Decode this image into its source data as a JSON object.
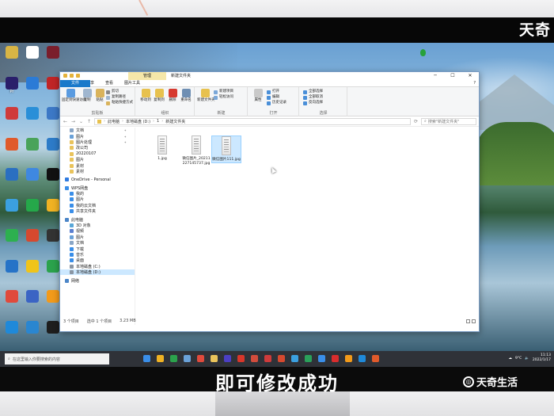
{
  "brand": {
    "top": "天奇",
    "bottom": "天奇生活"
  },
  "subtitle": "即可修改成功",
  "desktop": {
    "icons": [
      {
        "label": "",
        "color": "#d8b545"
      },
      {
        "label": "",
        "color": "#fff"
      },
      {
        "label": "",
        "color": "#7a1e2c"
      },
      {
        "label": "Pr",
        "color": "#2a1f6b"
      },
      {
        "label": "",
        "color": "#2b7bd6"
      },
      {
        "label": "",
        "color": "#c02526"
      },
      {
        "label": "",
        "color": "#cf3b3b"
      },
      {
        "label": "",
        "color": "#2a8fd8"
      },
      {
        "label": "",
        "color": "#3c78c6"
      },
      {
        "label": "",
        "color": "#e05a2b"
      },
      {
        "label": "",
        "color": "#4aa35a"
      },
      {
        "label": "",
        "color": "#2d7bc8"
      },
      {
        "label": "",
        "color": "#2a6fc1"
      },
      {
        "label": "",
        "color": "#3f88e0"
      },
      {
        "label": "",
        "color": "#111"
      },
      {
        "label": "",
        "color": "#3ba0e0"
      },
      {
        "label": "",
        "color": "#25a84a"
      },
      {
        "label": "",
        "color": "#f0b223"
      },
      {
        "label": "",
        "color": "#2db04f"
      },
      {
        "label": "",
        "color": "#d6492f"
      },
      {
        "label": "",
        "color": "#333"
      },
      {
        "label": "",
        "color": "#2673c7"
      },
      {
        "label": "",
        "color": "#f0c419"
      },
      {
        "label": "",
        "color": "#2ba24c"
      },
      {
        "label": "",
        "color": "#e04a3c"
      },
      {
        "label": "",
        "color": "#3b64c4"
      },
      {
        "label": "",
        "color": "#f29a1a"
      },
      {
        "label": "",
        "color": "#1f89d9"
      },
      {
        "label": "",
        "color": "#2a86d0"
      },
      {
        "label": "",
        "color": "#1e1e1e"
      }
    ]
  },
  "window": {
    "context_tab": "管理",
    "title": "新建文件夹",
    "controls": [
      "─",
      "☐",
      "✕"
    ],
    "tabs": {
      "file": "文件",
      "home": "主页",
      "share": "共享",
      "view": "查看",
      "picture_tools": "图片工具"
    },
    "help": "?",
    "ribbon": {
      "pin": "固定到快速访问",
      "copy": "复制",
      "paste": "粘贴",
      "cut": "剪切",
      "copy_path": "复制路径",
      "paste_shortcut": "粘贴快捷方式",
      "clipboard": "剪贴板",
      "move_to": "移动到",
      "copy_to": "复制到",
      "delete": "删除",
      "rename": "重命名",
      "organize": "组织",
      "new_item": "新建项目",
      "easy_access": "轻松访问",
      "new_folder": "新建文件夹",
      "new": "新建",
      "properties": "属性",
      "open": "打开",
      "edit": "编辑",
      "history": "历史记录",
      "open_group": "打开",
      "select_all": "全部选择",
      "select_none": "全部取消",
      "invert": "反向选择",
      "select_group": "选择"
    },
    "address": {
      "crumbs": [
        "此电脑",
        "本地磁盘 (D:)",
        "1",
        "新建文件夹"
      ],
      "search_placeholder": "搜索\"新建文件夹\""
    },
    "nav": [
      {
        "label": "文档",
        "color": "#8aa6c6",
        "pin": true
      },
      {
        "label": "图片",
        "color": "#6aa1d8",
        "pin": true
      },
      {
        "label": "图片处理",
        "color": "#e9c35b",
        "pin": true
      },
      {
        "label": "改公司",
        "color": "#e9c35b",
        "pin": false
      },
      {
        "label": "20220107",
        "color": "#e9c35b",
        "pin": false
      },
      {
        "label": "图片",
        "color": "#e9c35b",
        "pin": false
      },
      {
        "label": "素材",
        "color": "#e9c35b",
        "pin": false
      },
      {
        "label": "素材",
        "color": "#e9c35b",
        "pin": false
      },
      {
        "label": "OneDrive - Personal",
        "color": "#2f7be0",
        "pin": false,
        "head": true
      },
      {
        "label": "WPS网盘",
        "color": "#3a8ee8",
        "pin": false,
        "head": true
      },
      {
        "label": "我的",
        "color": "#3a8ee8",
        "pin": false
      },
      {
        "label": "图片",
        "color": "#3a8ee8",
        "pin": false
      },
      {
        "label": "我的云文档",
        "color": "#3a8ee8",
        "pin": false
      },
      {
        "label": "共享文件夹",
        "color": "#3a8ee8",
        "pin": false
      },
      {
        "label": "此电脑",
        "color": "#4c86c8",
        "pin": false,
        "head": true
      },
      {
        "label": "3D 对象",
        "color": "#59a7d8",
        "pin": false
      },
      {
        "label": "视频",
        "color": "#5a7fd0",
        "pin": false
      },
      {
        "label": "图片",
        "color": "#6aa1d8",
        "pin": false
      },
      {
        "label": "文档",
        "color": "#8aa6c6",
        "pin": false
      },
      {
        "label": "下载",
        "color": "#3a8ee8",
        "pin": false
      },
      {
        "label": "音乐",
        "color": "#3a8ee8",
        "pin": false
      },
      {
        "label": "桌面",
        "color": "#3a8ee8",
        "pin": false
      },
      {
        "label": "本地磁盘 (C:)",
        "color": "#8a96a4",
        "pin": false
      },
      {
        "label": "本地磁盘 (D:)",
        "color": "#8a96a4",
        "pin": false,
        "selected": true
      },
      {
        "label": "网络",
        "color": "#4c86c8",
        "pin": false,
        "head": true
      }
    ],
    "files": [
      {
        "name": "1.jpg"
      },
      {
        "name": "微信图片_20211227145737.jpg"
      },
      {
        "name": "微信图片111.jpg",
        "selected": true
      }
    ],
    "status": {
      "count": "3 个项目",
      "selected": "选中 1 个项目",
      "size": "3.23 MB"
    }
  },
  "taskbar": {
    "search_placeholder": "在这里输入你要搜索的内容",
    "apps": [
      "#3a8ee8",
      "#f0b223",
      "#2ba24c",
      "#6aa1d8",
      "#e04a3c",
      "#e9c35b",
      "#4b3fc4",
      "#d8362a",
      "#d24c3c",
      "#cf3b3b",
      "#d6492f",
      "#3ba0e0",
      "#2aa05a",
      "#3a8ee8",
      "#d92d2d",
      "#f29a1a",
      "#1f89d9",
      "#e05a2b"
    ],
    "weather": "9°C",
    "time": "11:13",
    "date": "2022/1/17"
  }
}
